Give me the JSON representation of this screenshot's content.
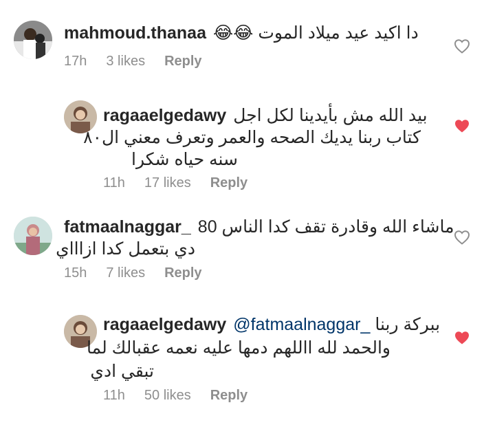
{
  "comments": [
    {
      "username": "mahmoud.thanaa",
      "lines": [
        "دا اكيد عيد ميلاد الموت 😂😂"
      ],
      "time": "17h",
      "likes": "3 likes",
      "reply": "Reply",
      "liked": false,
      "avatar_icon": "person-avatar-icon"
    },
    {
      "username": "ragaaelgedawy",
      "lines": [
        "بيد الله مش بأيدينا لكل اجل",
        "كتاب ربنا يديك الصحه والعمر وتعرف معني ال٨٠",
        "سنه حياه شكرا"
      ],
      "time": "11h",
      "likes": "17 likes",
      "reply": "Reply",
      "liked": true,
      "avatar_icon": "person-avatar-icon"
    },
    {
      "username": "fatmaalnaggar_",
      "lines": [
        "ماشاء الله وقادرة تقف كدا الناس 80",
        "دي بتعمل كدا ازاااي"
      ],
      "time": "15h",
      "likes": "7 likes",
      "reply": "Reply",
      "liked": false,
      "avatar_icon": "person-avatar-icon"
    },
    {
      "username": "ragaaelgedawy",
      "mention": "@fatmaalnaggar_",
      "lines": [
        "ببركة ربنا",
        "والحمد لله االلهم دمها عليه نعمه عقبالك لما",
        "تبقي ادي"
      ],
      "time": "11h",
      "likes": "50 likes",
      "reply": "Reply",
      "liked": true,
      "avatar_icon": "person-avatar-icon"
    }
  ],
  "colors": {
    "text": "#262626",
    "meta": "#8e8e8e",
    "heart_liked": "#ed4956",
    "heart_outline": "#8e8e8e",
    "mention": "#003569"
  }
}
